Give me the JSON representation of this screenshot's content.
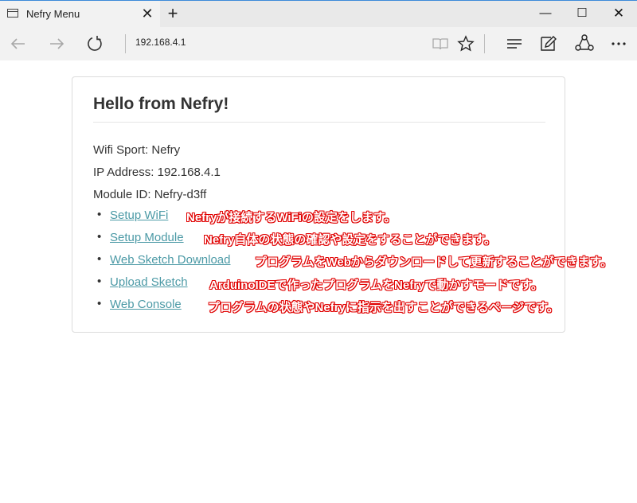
{
  "tab": {
    "title": "Nefry Menu",
    "close_glyph": "✕",
    "new_tab_glyph": "+"
  },
  "window": {
    "minimize_glyph": "—",
    "maximize_glyph": "☐",
    "close_glyph": "✕"
  },
  "toolbar": {
    "address": "192.168.4.1",
    "icons": [
      "back-icon",
      "forward-icon",
      "refresh-icon",
      "reading-view-icon",
      "favorite-star-icon",
      "hub-icon",
      "web-note-icon",
      "share-icon",
      "more-icon"
    ]
  },
  "page": {
    "heading": "Hello from Nefry!",
    "info": {
      "wifi": "Wifi Sport: Nefry",
      "ip": "IP Address: 192.168.4.1",
      "module": "Module ID: Nefry-d3ff"
    },
    "links": [
      {
        "label": "Setup WiFi",
        "note": "Nefryが接続するWiFiの設定をします。"
      },
      {
        "label": "Setup Module",
        "note": "Nefry自体の状態の確認や設定をすることができます。"
      },
      {
        "label": "Web Sketch Download",
        "note": "プログラムをWebからダウンロードして更新することができます。"
      },
      {
        "label": "Upload Sketch",
        "note": "ArduinoIDEで作ったプログラムをNefryで動かすモードです。"
      },
      {
        "label": "Web Console",
        "note": "プログラムの状態やNefryに指示を出すことができるページです。"
      }
    ],
    "bullet": "•"
  },
  "colors": {
    "link": "#4c9aa6",
    "annotation": "#e00000",
    "heading": "#333333"
  }
}
